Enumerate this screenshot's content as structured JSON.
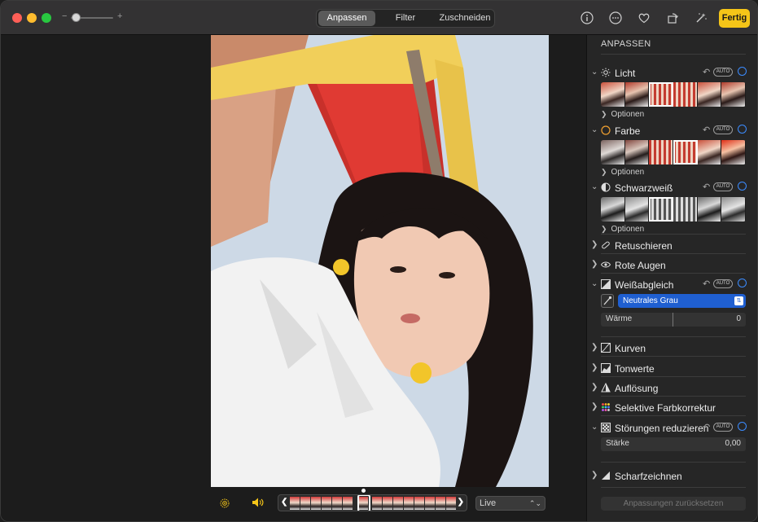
{
  "toolbar": {
    "zoom_minus": "−",
    "zoom_plus": "+",
    "tabs": [
      {
        "label": "Anpassen",
        "active": true
      },
      {
        "label": "Filter",
        "active": false
      },
      {
        "label": "Zuschneiden",
        "active": false
      }
    ],
    "done_label": "Fertig",
    "icons": [
      "info-icon",
      "more-icon",
      "heart-icon",
      "rotate-icon",
      "magic-wand-icon"
    ],
    "accent_color": "#f5c518"
  },
  "photo": {
    "description_colors": {
      "sky": "#c9d6e4",
      "awning": "#c4332c",
      "hair": "#1b1413",
      "shirt": "#f2f2f2"
    }
  },
  "bottom": {
    "live_select": "Live",
    "filmstrip_frames": 17
  },
  "sidebar": {
    "title": "ANPASSEN",
    "sections": {
      "licht": {
        "label": "Licht",
        "auto": "AUTO",
        "options": "Optionen"
      },
      "farbe": {
        "label": "Farbe",
        "auto": "AUTO",
        "options": "Optionen"
      },
      "schwarzweiss": {
        "label": "Schwarzweiß",
        "auto": "AUTO",
        "options": "Optionen"
      },
      "retuschieren": {
        "label": "Retuschieren"
      },
      "rote_augen": {
        "label": "Rote Augen"
      },
      "weissabgleich": {
        "label": "Weißabgleich",
        "auto": "AUTO",
        "preset": "Neutrales Grau",
        "slider_label": "Wärme",
        "slider_value": "0"
      },
      "kurven": {
        "label": "Kurven"
      },
      "tonwerte": {
        "label": "Tonwerte"
      },
      "aufloesung": {
        "label": "Auflösung"
      },
      "selektive": {
        "label": "Selektive Farbkorrektur"
      },
      "stoerungen": {
        "label": "Störungen reduzieren",
        "auto": "AUTO",
        "slider_label": "Stärke",
        "slider_value": "0,00"
      },
      "scharfzeichnen": {
        "label": "Scharfzeichnen"
      }
    },
    "reset_label": "Anpassungen zurücksetzen",
    "ring_color": "#3c8cff"
  }
}
